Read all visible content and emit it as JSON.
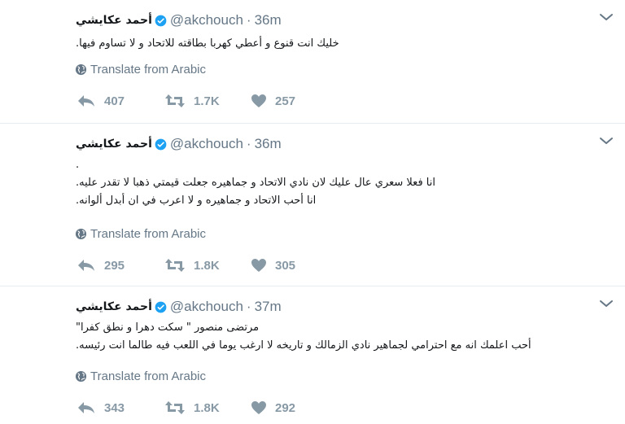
{
  "colors": {
    "muted": "#657786",
    "icon": "#8899a6",
    "verified": "#1da1f2",
    "divider": "#e6ecf0"
  },
  "tweets": [
    {
      "name": "أحمد عكايشي",
      "handle": "@akchouch",
      "separator": "·",
      "time": "36m",
      "lines": [
        "خليك انت قنوع و أعطي كهربا بطاقته للاتحاد و لا تساوم فيها."
      ],
      "translate": "Translate from Arabic",
      "reply_count": "407",
      "retweet_count": "1.7K",
      "like_count": "257"
    },
    {
      "name": "أحمد عكايشي",
      "handle": "@akchouch",
      "separator": "·",
      "time": "36m",
      "lines": [
        ".",
        "انا فعلا سعري عال عليك لان نادي الاتحاد و جماهيره جعلت قيمتي ذهبا لا تقدر عليه.",
        "انا أحب الاتحاد و جماهيره و لا اعرب في ان أبدل ألوانه."
      ],
      "translate": "Translate from Arabic",
      "reply_count": "295",
      "retweet_count": "1.8K",
      "like_count": "305"
    },
    {
      "name": "أحمد عكايشي",
      "handle": "@akchouch",
      "separator": "·",
      "time": "37m",
      "lines": [
        "مرتضى منصور \" سكت دهرا و نطق كفرا\"",
        "أحب اعلمك انه مع احترامي لجماهير نادي الزمالك و تاريخه لا ارغب يوما في اللعب فيه طالما انت رئيسه."
      ],
      "translate": "Translate from Arabic",
      "reply_count": "343",
      "retweet_count": "1.8K",
      "like_count": "292"
    }
  ]
}
